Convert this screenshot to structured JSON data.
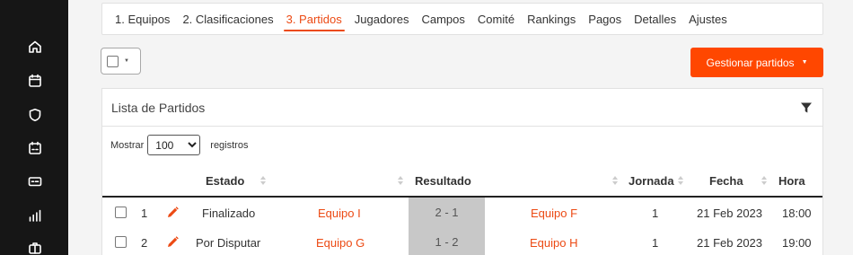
{
  "sidebar": {
    "icons": [
      "home-icon",
      "calendar-icon",
      "shield-icon",
      "calendar-versus-icon",
      "ticket-icon",
      "bar-chart-icon",
      "briefcase-icon"
    ]
  },
  "tabs": [
    {
      "label": "1. Equipos",
      "active": false
    },
    {
      "label": "2. Clasificaciones",
      "active": false
    },
    {
      "label": "3. Partidos",
      "active": true
    },
    {
      "label": "Jugadores",
      "active": false
    },
    {
      "label": "Campos",
      "active": false
    },
    {
      "label": "Comité",
      "active": false
    },
    {
      "label": "Rankings",
      "active": false
    },
    {
      "label": "Pagos",
      "active": false
    },
    {
      "label": "Detalles",
      "active": false
    },
    {
      "label": "Ajustes",
      "active": false
    }
  ],
  "toolbar": {
    "manage_label": "Gestionar partidos"
  },
  "panel": {
    "title": "Lista de Partidos",
    "show_label": "Mostrar",
    "page_size": "100",
    "records_label": "registros"
  },
  "table": {
    "headers": {
      "estado": "Estado",
      "resultado": "Resultado",
      "jornada": "Jornada",
      "fecha": "Fecha",
      "hora": "Hora"
    },
    "rows": [
      {
        "num": "1",
        "estado": "Finalizado",
        "local": "Equipo I",
        "resultado": "2 - 1",
        "visitante": "Equipo F",
        "jornada": "1",
        "fecha": "21 Feb 2023",
        "hora": "18:00"
      },
      {
        "num": "2",
        "estado": "Por Disputar",
        "local": "Equipo G",
        "resultado": "1 - 2",
        "visitante": "Equipo H",
        "jornada": "1",
        "fecha": "21 Feb 2023",
        "hora": "19:00"
      }
    ]
  },
  "colors": {
    "accent": "#ec4a14",
    "button": "#ff4700",
    "sidebar": "#161616",
    "score_bg": "#c8c8c8"
  }
}
